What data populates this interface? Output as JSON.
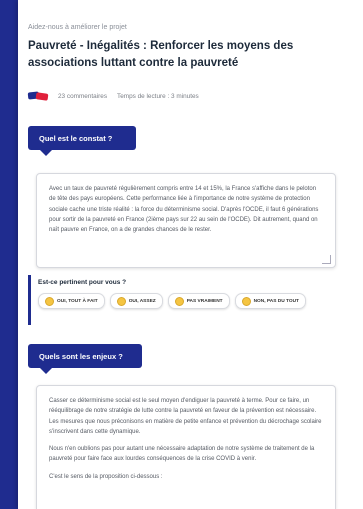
{
  "kicker": "Aidez-nous à améliorer le projet",
  "title": "Pauvreté - Inégalités : Renforcer les moyens des associations luttant contre la pauvreté",
  "meta": {
    "comments": "23 commentaires",
    "reading_time": "Temps de lecture : 3 minutes"
  },
  "section1": {
    "heading": "Quel est le constat ?",
    "text": "Avec un taux de pauvreté régulièrement compris entre 14 et 15%, la France s'affiche dans le peloton de tête des pays européens. Cette performance liée à l'importance de notre système de protection sociale cache une triste réalité : la force du déterminisme social. D'après l'OCDE, il faut 6 générations pour sortir de la pauvreté en France (2ième pays sur 22 au sein de l'OCDE). Dit autrement, quand on naît pauvre en France, on a de grandes chances de le rester."
  },
  "poll": {
    "question": "Est-ce pertinent pour vous ?",
    "options": [
      "OUI, TOUT À FAIT",
      "OUI, ASSEZ",
      "PAS VRAIMENT",
      "NON, PAS DU TOUT"
    ]
  },
  "section2": {
    "heading": "Quels sont les enjeux ?",
    "p1": "Casser ce déterminisme social est le seul moyen d'endiguer la pauvreté à terme. Pour ce faire, un rééquilibrage de notre stratégie de lutte contre la pauvreté en faveur de la prévention est nécessaire. Les mesures que nous préconisons en matière de petite enfance et prévention du décrochage scolaire s'inscrivent dans cette dynamique.",
    "p2": "Nous n'en oublions pas pour autant une nécessaire adaptation de notre système de traitement de la pauvreté pour faire face aux lourdes conséquences de la crise COVID à venir.",
    "p3": "C'est le sens de la proposition ci-dessous :"
  },
  "colors": {
    "accent": "#1f2c8f",
    "flag_red": "#e0203b"
  }
}
